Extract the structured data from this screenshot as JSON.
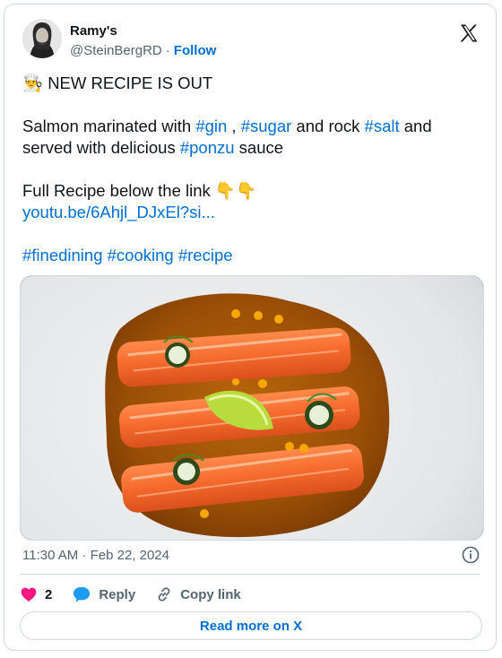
{
  "author": {
    "name": "Ramy's",
    "handle": "@SteinBergRD",
    "separator": "·",
    "follow_label": "Follow"
  },
  "post": {
    "line1_emoji": "👨‍🍳",
    "line1_text": "NEW RECIPE IS OUT",
    "line2": [
      "Salmon marinated with ",
      "#gin",
      " , ",
      "#sugar",
      " and rock ",
      "#salt",
      " and"
    ],
    "line3": [
      "served with delicious ",
      "#ponzu",
      " sauce"
    ],
    "line4_text": "Full Recipe below the link",
    "line4_emoji": "👇👇",
    "link": "youtu.be/6Ahjl_DJxEl?si...",
    "hashtags": [
      "#finedining",
      "#cooking",
      "#recipe"
    ]
  },
  "meta": {
    "time": "11:30 AM · Feb 22, 2024"
  },
  "actions": {
    "likes": "2",
    "reply_label": "Reply",
    "copy_label": "Copy link"
  },
  "read_more_label": "Read more on X",
  "colors": {
    "link": "#006fd6",
    "like": "#f91880",
    "reply": "#1d9bf0",
    "muted": "#536471",
    "border": "#cfd9de"
  },
  "icons": [
    "x-logo-icon",
    "info-icon",
    "heart-icon",
    "reply-bubble-icon",
    "link-icon"
  ]
}
